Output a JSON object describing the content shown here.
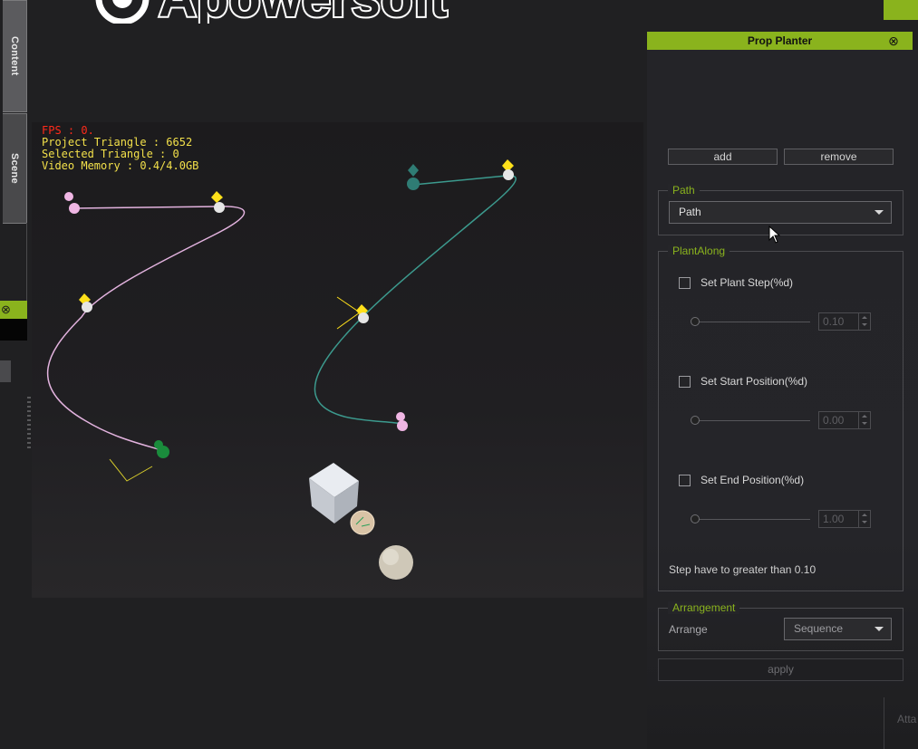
{
  "app": {
    "watermark": "Apowersoft"
  },
  "left_tabs": {
    "content": "Content",
    "scene": "Scene"
  },
  "panel": {
    "title": "Prop Planter",
    "add_label": "add",
    "remove_label": "remove",
    "path_group": {
      "title": "Path",
      "selected": "Path"
    },
    "plant_along": {
      "title": "PlantAlong",
      "options": [
        {
          "label": "Set Plant Step(%d)",
          "checked": false,
          "value": "0.10",
          "slider_fraction": 0.0
        },
        {
          "label": "Set Start Position(%d)",
          "checked": false,
          "value": "0.00",
          "slider_fraction": 0.0
        },
        {
          "label": "Set End Position(%d)",
          "checked": false,
          "value": "1.00",
          "slider_fraction": 0.0
        }
      ],
      "note": "Step have to greater than 0.10"
    },
    "arrangement": {
      "title": "Arrangement",
      "label": "Arrange",
      "selected": "Sequence"
    },
    "apply_label": "apply"
  },
  "viewport": {
    "fps": "FPS : 0.",
    "project_triangle": "Project Triangle : 6652",
    "selected_triangle": "Selected Triangle : 0",
    "video_memory": "Video Memory : 0.4/4.0GB"
  },
  "bottom_right_text": "Atta",
  "colors": {
    "accent": "#8ab31d",
    "fps": "#ff2a1a",
    "stats": "#f2e04a",
    "pink_path": "#e3b3df",
    "teal_path": "#3c9a8e"
  }
}
